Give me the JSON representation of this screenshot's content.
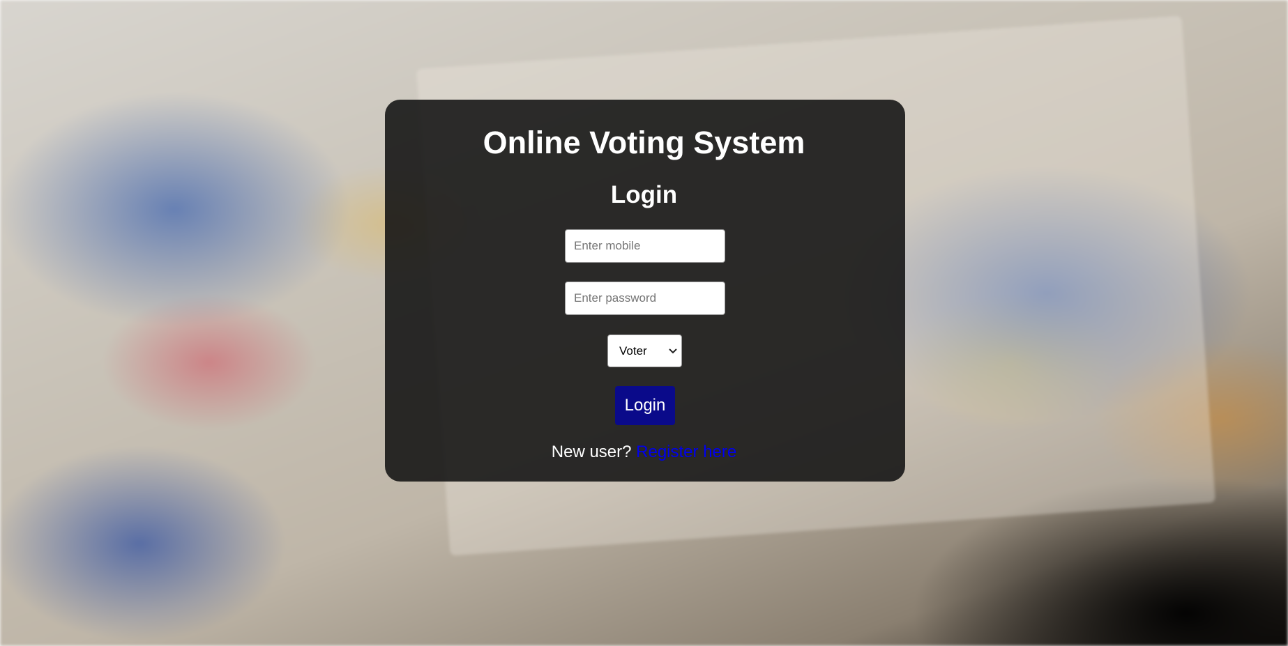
{
  "page": {
    "title": "Online Voting System",
    "subtitle": "Login"
  },
  "form": {
    "mobile_placeholder": "Enter mobile",
    "password_placeholder": "Enter password",
    "role_selected": "Voter",
    "login_label": "Login"
  },
  "footer": {
    "prompt": "New user? ",
    "register_label": "Register here"
  },
  "colors": {
    "card_background": "#121212",
    "login_button": "#0a0a8a",
    "link": "#0000ee"
  },
  "icons": {
    "select_arrow": "chevron-down-icon"
  }
}
